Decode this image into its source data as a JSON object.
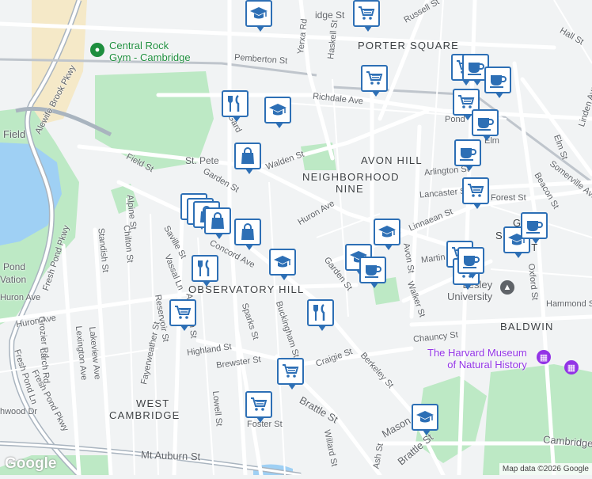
{
  "map": {
    "attribution": "Map data ©2026 Google",
    "logo": "Google",
    "colors": {
      "water": "#9fd0f4",
      "park": "#bde9c5",
      "road": "#ffffff",
      "base": "#f1f3f4",
      "marker_border": "#2d6fb5",
      "highway": "#a9b4bf",
      "sand": "#f5e9c8"
    }
  },
  "areas": [
    {
      "id": "porter",
      "text": "PORTER SQUARE"
    },
    {
      "id": "avon",
      "text": "AVON HILL"
    },
    {
      "id": "nn1",
      "text": "NEIGHBORHOOD"
    },
    {
      "id": "nn2",
      "text": "NINE"
    },
    {
      "id": "obs",
      "text": "OBSERVATORY HILL"
    },
    {
      "id": "baldwin",
      "text": "BALDWIN"
    },
    {
      "id": "west1",
      "text": "WEST"
    },
    {
      "id": "west2",
      "text": "CAMBRIDGE"
    },
    {
      "id": "garden1",
      "text": "GARD"
    },
    {
      "id": "garden2",
      "text": "STREET"
    },
    {
      "id": "garden3",
      "text": "DIST"
    }
  ],
  "streets": [
    "Alewife Brook Pkwy",
    "Fresh Pond Pkwy",
    "Fresh Pond Pkwy",
    "Field St",
    "Field",
    "Pemberton St",
    "Richdale Ave",
    "Walden St",
    "Garden St",
    "Huron Ave",
    "Huron Ave",
    "Linnaean St",
    "Avon St",
    "Walker St",
    "Chauncy St",
    "Oxford St",
    "Hammond St",
    "Elm St",
    "Somerville Ave",
    "Beacon St",
    "Hall St",
    "Linden Ave",
    "Russell St",
    "Arlington St",
    "Lancaster St",
    "Forest St",
    "Martin St",
    "Concord Ave",
    "Saville St",
    "Vassal Ln",
    "Alpine St",
    "Standish St",
    "Chilton St",
    "Appleton St",
    "Reservoir St",
    "Highland St",
    "Brewster St",
    "Sparks St",
    "Buckingham St",
    "Craigie St",
    "Berkeley St",
    "Brattle St",
    "Brattle St",
    "Mason St",
    "Mt Auburn St",
    "Cambridge",
    "Fayerweather St",
    "Lakeview Ave",
    "Lexington Ave",
    "Grozier Rd",
    "Larch Rd",
    "Fresh Pond Ln",
    "Lowell St",
    "Foster St",
    "Willard St",
    "Ash St",
    "Haskell St",
    "Yerxa Rd",
    "Garden St",
    "Gard",
    "Pond",
    "Elm",
    "Huron Ave",
    "Pond",
    "Vation",
    "hwood Dr",
    "Ca",
    "idge St",
    "St. Pete"
  ],
  "pois": [
    {
      "id": "rock",
      "text1": "Central Rock",
      "text2": "Gym - Cambridge",
      "color": "#1e8e3e"
    },
    {
      "id": "harvard",
      "text1": "The Harvard Museum",
      "text2": "of Natural History",
      "color": "#9334e6"
    },
    {
      "id": "lesley",
      "text1": "Lesley",
      "text2": "University",
      "color": "#5f6368"
    }
  ],
  "markers": [
    {
      "type": "school"
    },
    {
      "type": "cart"
    },
    {
      "type": "cart"
    },
    {
      "type": "cart"
    },
    {
      "type": "cafe"
    },
    {
      "type": "cafe"
    },
    {
      "type": "cart"
    },
    {
      "type": "cafe"
    },
    {
      "type": "cafe"
    },
    {
      "type": "restaurant"
    },
    {
      "type": "school"
    },
    {
      "type": "shop"
    },
    {
      "type": "shop"
    },
    {
      "type": "cart"
    },
    {
      "type": "shop"
    },
    {
      "type": "shop"
    },
    {
      "type": "shop"
    },
    {
      "type": "school"
    },
    {
      "type": "restaurant"
    },
    {
      "type": "school"
    },
    {
      "type": "cafe"
    },
    {
      "type": "school"
    },
    {
      "type": "shop"
    },
    {
      "type": "restaurant"
    },
    {
      "type": "cart"
    },
    {
      "type": "cart"
    },
    {
      "type": "cart"
    },
    {
      "type": "school"
    },
    {
      "type": "cafe"
    },
    {
      "type": "school"
    },
    {
      "type": "cafe"
    },
    {
      "type": "cart"
    },
    {
      "type": "cart"
    }
  ]
}
